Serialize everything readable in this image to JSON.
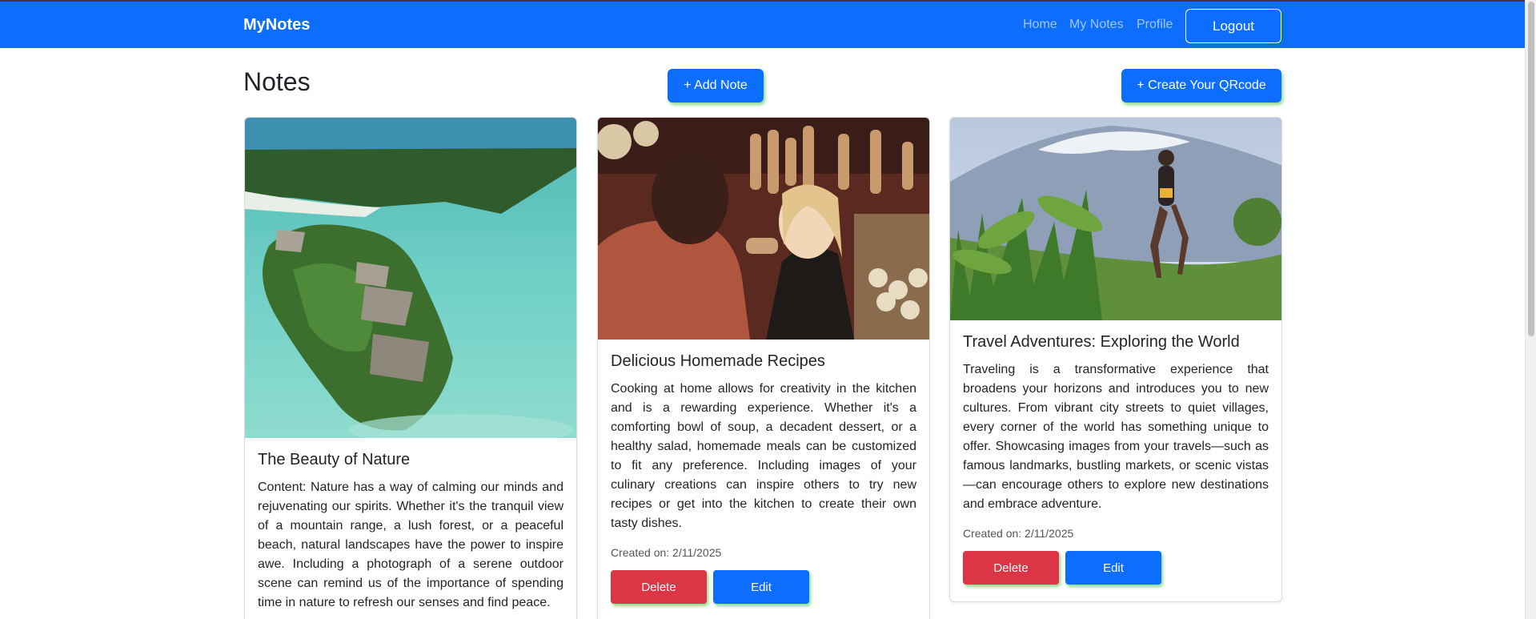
{
  "navbar": {
    "brand": "MyNotes",
    "links": [
      "Home",
      "My Notes",
      "Profile"
    ],
    "logout": "Logout",
    "bg_color": "#0d6efd"
  },
  "header": {
    "title": "Notes",
    "add_note": "+ Add Note",
    "create_qr": "+ Create Your QRcode"
  },
  "cards": [
    {
      "title": "The Beauty of Nature",
      "text": "Content: Nature has a way of calming our minds and rejuvenating our spirits. Whether it's the tranquil view of a mountain range, a lush forest, or a peaceful beach, natural landscapes have the power to inspire awe. Including a photograph of a serene outdoor scene can remind us of the importance of spending time in nature to refresh our senses and find peace.",
      "image": "island-aerial-photo"
    },
    {
      "title": "Delicious Homemade Recipes",
      "text": "Cooking at home allows for creativity in the kitchen and is a rewarding experience. Whether it's a comforting bowl of soup, a decadent dessert, or a healthy salad, homemade meals can be customized to fit any preference. Including images of your culinary creations can inspire others to try new recipes or get into the kitchen to create their own tasty dishes.",
      "created": "Created on: 2/11/2025",
      "delete": "Delete",
      "edit": "Edit",
      "image": "market-spices-photo"
    },
    {
      "title": "Travel Adventures: Exploring the World",
      "text": "Traveling is a transformative experience that broadens your horizons and introduces you to new cultures. From vibrant city streets to quiet villages, every corner of the world has something unique to offer. Showcasing images from your travels—such as famous landmarks, bustling markets, or scenic vistas—can encourage others to explore new destinations and embrace adventure.",
      "created": "Created on: 2/11/2025",
      "delete": "Delete",
      "edit": "Edit",
      "image": "mountain-runner-photo"
    }
  ]
}
